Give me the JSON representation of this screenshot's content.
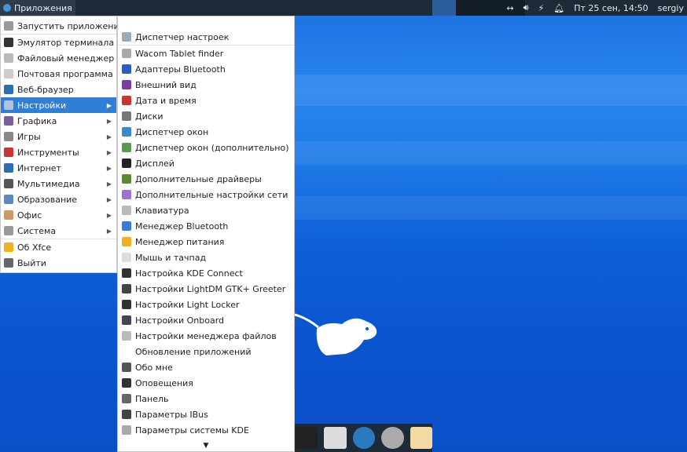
{
  "panel": {
    "apps_label": "Приложения",
    "clock": "Пт 25 сен, 14:50",
    "user": "sergiy"
  },
  "main_menu": [
    {
      "label": "Запустить приложение...",
      "icon": "gears-icon",
      "color": "#999"
    },
    {
      "label": "Эмулятор терминала",
      "icon": "terminal-icon",
      "color": "#333"
    },
    {
      "label": "Файловый менеджер",
      "icon": "folder-icon",
      "color": "#bbb"
    },
    {
      "label": "Почтовая программа",
      "icon": "mail-icon",
      "color": "#ccc"
    },
    {
      "label": "Веб-браузер",
      "icon": "globe-icon",
      "color": "#2a6fb0"
    },
    {
      "label": "Настройки",
      "icon": "settings-icon",
      "color": "#b0c4de",
      "submenu": true,
      "selected": true
    },
    {
      "label": "Графика",
      "icon": "graphics-icon",
      "color": "#7a5ea0",
      "submenu": true
    },
    {
      "label": "Игры",
      "icon": "games-icon",
      "color": "#888",
      "submenu": true
    },
    {
      "label": "Инструменты",
      "icon": "tools-icon",
      "color": "#c33",
      "submenu": true
    },
    {
      "label": "Интернет",
      "icon": "internet-icon",
      "color": "#2a6fb0",
      "submenu": true
    },
    {
      "label": "Мультимедиа",
      "icon": "multimedia-icon",
      "color": "#555",
      "submenu": true
    },
    {
      "label": "Образование",
      "icon": "education-icon",
      "color": "#5a8ac0",
      "submenu": true
    },
    {
      "label": "Офис",
      "icon": "office-icon",
      "color": "#c96",
      "submenu": true
    },
    {
      "label": "Система",
      "icon": "system-icon",
      "color": "#999",
      "submenu": true
    },
    {
      "label": "Об Xfce",
      "icon": "star-icon",
      "color": "#f0b020"
    },
    {
      "label": "Выйти",
      "icon": "logout-icon",
      "color": "#666"
    }
  ],
  "settings_menu": [
    {
      "label": "Диспетчер настроек",
      "icon": "settings-manager-icon",
      "color": "#9ab"
    },
    {
      "label": "Wacom Tablet finder",
      "icon": "tablet-icon",
      "color": "#aaa"
    },
    {
      "label": "Адаптеры Bluetooth",
      "icon": "bluetooth-icon",
      "color": "#2a5fc0"
    },
    {
      "label": "Внешний вид",
      "icon": "appearance-icon",
      "color": "#7a3ea0"
    },
    {
      "label": "Дата и время",
      "icon": "calendar-icon",
      "color": "#c33"
    },
    {
      "label": "Диски",
      "icon": "disks-icon",
      "color": "#777"
    },
    {
      "label": "Диспетчер окон",
      "icon": "window-manager-icon",
      "color": "#3a8ad0"
    },
    {
      "label": "Диспетчер окон (дополнительно)",
      "icon": "window-manager-tweaks-icon",
      "color": "#5a9a50"
    },
    {
      "label": "Дисплей",
      "icon": "display-icon",
      "color": "#222"
    },
    {
      "label": "Дополнительные драйверы",
      "icon": "drivers-icon",
      "color": "#5a8a30"
    },
    {
      "label": "Дополнительные настройки сети",
      "icon": "network-icon",
      "color": "#a070d0"
    },
    {
      "label": "Клавиатура",
      "icon": "keyboard-icon",
      "color": "#bbb"
    },
    {
      "label": "Менеджер Bluetooth",
      "icon": "bluetooth-icon",
      "color": "#3a7ad8"
    },
    {
      "label": "Менеджер питания",
      "icon": "power-icon",
      "color": "#f0b020"
    },
    {
      "label": "Мышь и тачпад",
      "icon": "mouse-icon",
      "color": "#ddd"
    },
    {
      "label": "Настройка KDE Connect",
      "icon": "phone-icon",
      "color": "#333"
    },
    {
      "label": "Настройки LightDM GTK+ Greeter",
      "icon": "greeter-icon",
      "color": "#444"
    },
    {
      "label": "Настройки Light Locker",
      "icon": "lock-screen-icon",
      "color": "#333"
    },
    {
      "label": "Настройки Onboard",
      "icon": "onboard-keyboard-icon",
      "color": "#445"
    },
    {
      "label": "Настройки менеджера файлов",
      "icon": "folder-icon",
      "color": "#bbb"
    },
    {
      "label": "Обновление приложений",
      "icon": "update-icon",
      "color": "#fff"
    },
    {
      "label": "Обо мне",
      "icon": "user-icon",
      "color": "#555"
    },
    {
      "label": "Оповещения",
      "icon": "notifications-icon",
      "color": "#333"
    },
    {
      "label": "Панель",
      "icon": "panel-icon",
      "color": "#666"
    },
    {
      "label": "Параметры IBus",
      "icon": "ibus-icon",
      "color": "#444"
    },
    {
      "label": "Параметры системы KDE",
      "icon": "kde-settings-icon",
      "color": "#aaa"
    }
  ],
  "dock": [
    {
      "icon": "terminal-icon",
      "color": "#222"
    },
    {
      "icon": "home-folder-icon",
      "color": "#ddd"
    },
    {
      "icon": "web-browser-icon",
      "color": "#2a7ac0"
    },
    {
      "icon": "search-icon",
      "color": "#aaa"
    },
    {
      "icon": "folder-icon",
      "color": "#f3d9a4"
    }
  ]
}
